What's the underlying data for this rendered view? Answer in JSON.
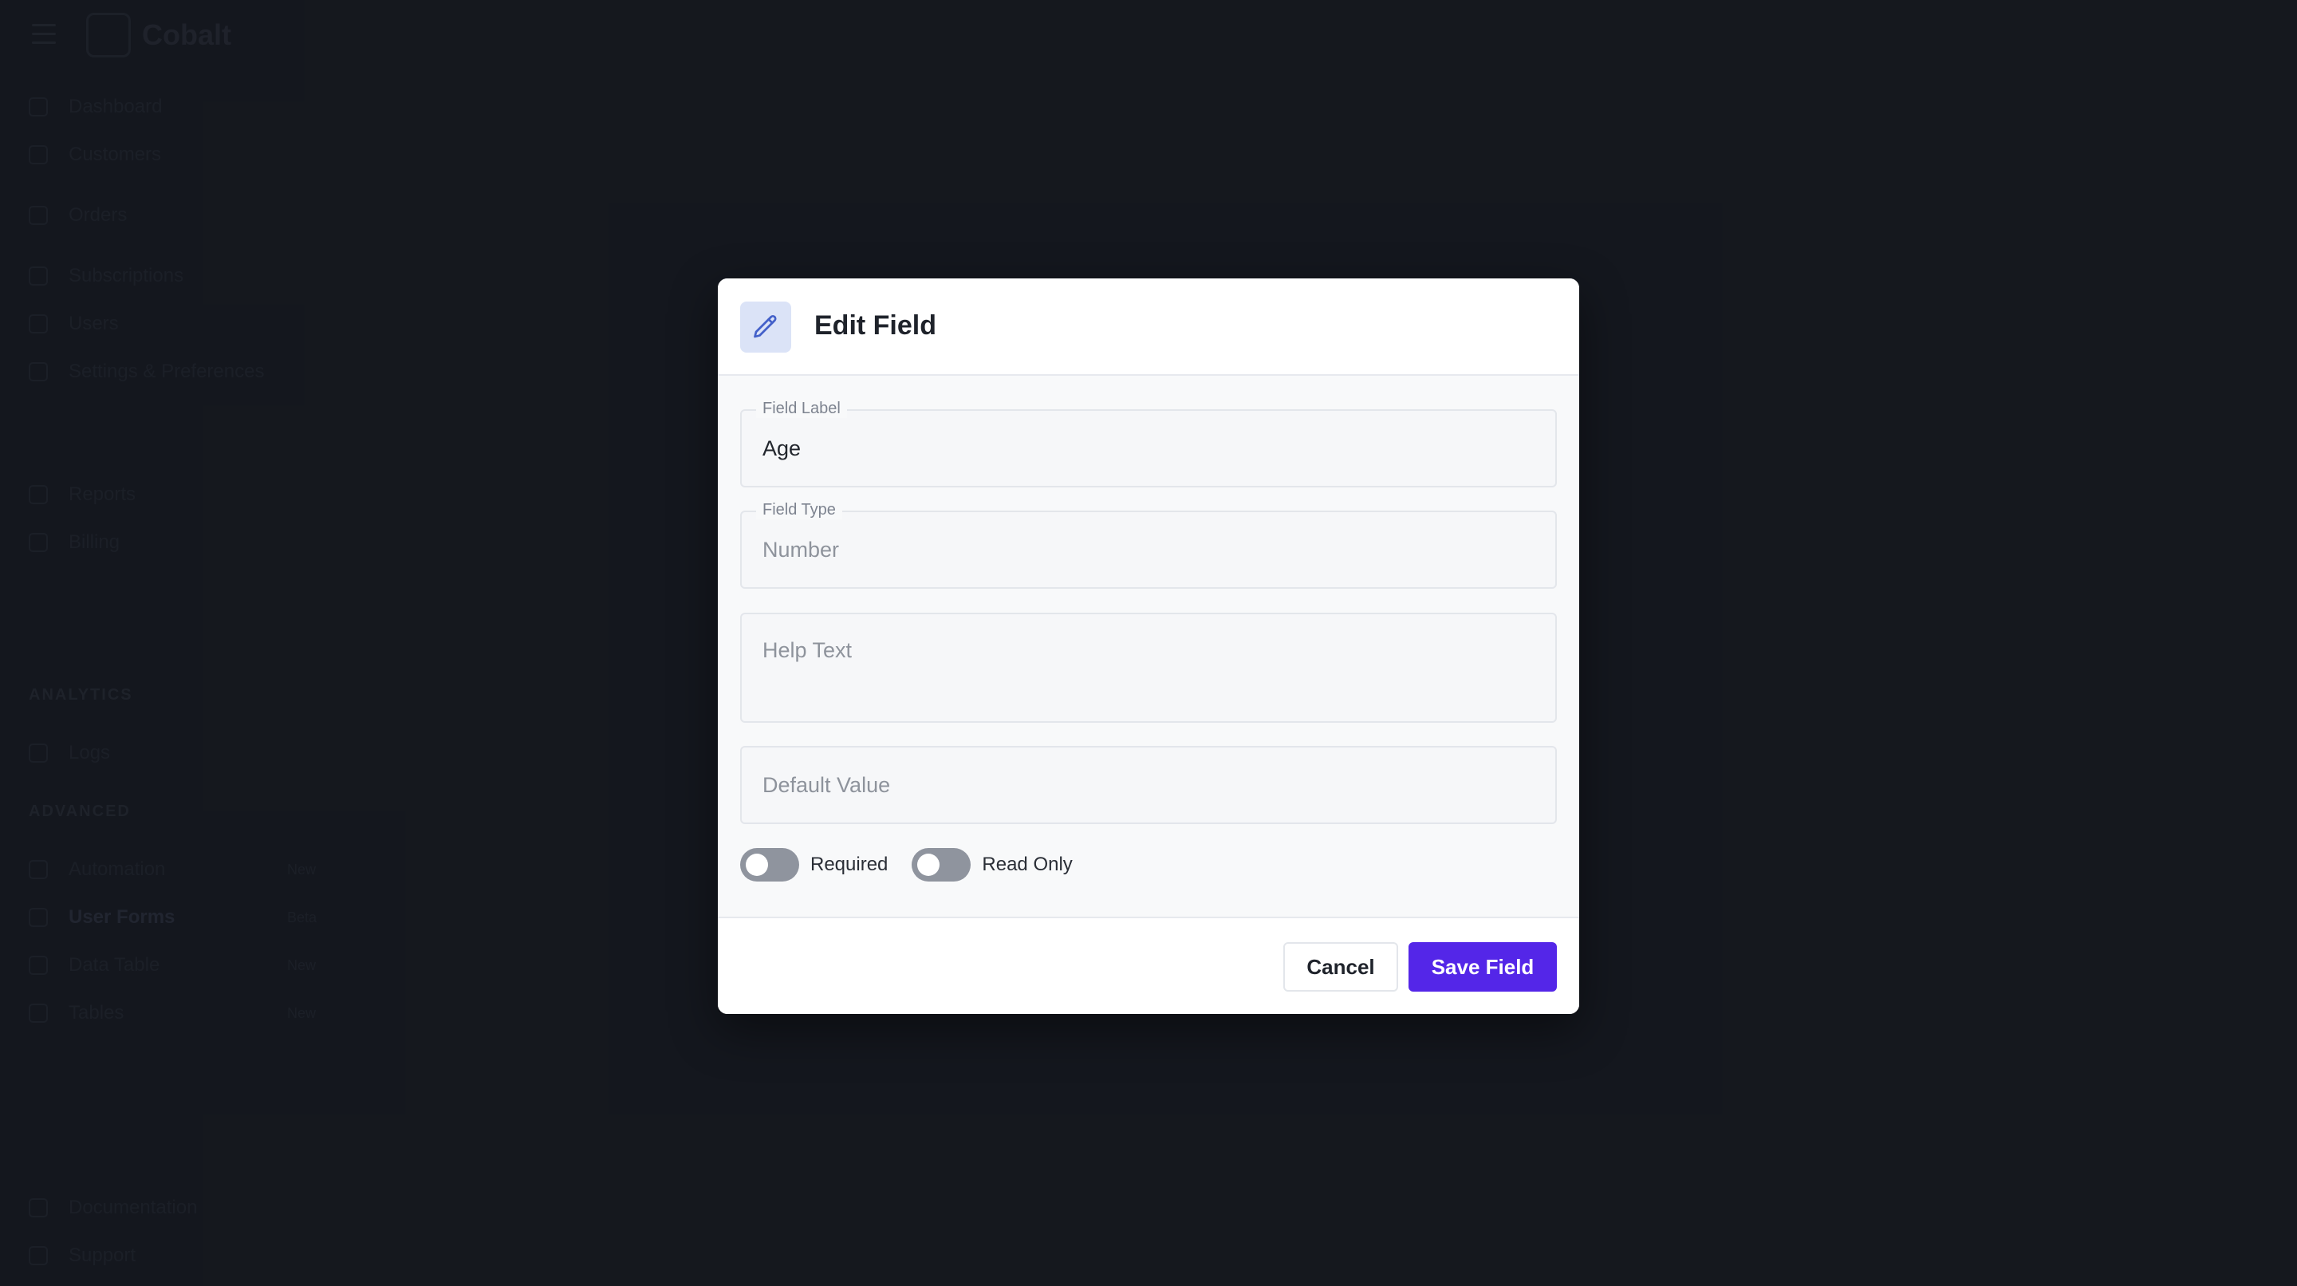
{
  "app": {
    "brand": "Cobalt",
    "sidebar": {
      "sections": [
        "ANALYTICS",
        "ADVANCED"
      ],
      "items": [
        {
          "label": "Dashboard"
        },
        {
          "label": "Customers"
        },
        {
          "label": "Orders"
        },
        {
          "label": "Subscriptions"
        },
        {
          "label": "Users"
        },
        {
          "label": "Settings & Preferences"
        },
        {
          "label": "Reports"
        },
        {
          "label": "Billing"
        },
        {
          "label": "Logs"
        },
        {
          "label": "Automation",
          "badge": "New"
        },
        {
          "label": "User Forms",
          "badge": "Beta"
        },
        {
          "label": "Data Table",
          "badge": "New"
        },
        {
          "label": "Tables",
          "badge": "New"
        },
        {
          "label": "Documentation"
        },
        {
          "label": "Support"
        }
      ]
    }
  },
  "modal": {
    "title": "Edit Field",
    "icon": "pencil-icon",
    "fields": {
      "label": {
        "legend": "Field Label",
        "value": "Age"
      },
      "type": {
        "legend": "Field Type",
        "value": "Number"
      },
      "help": {
        "placeholder": "Help Text"
      },
      "default": {
        "placeholder": "Default Value"
      }
    },
    "toggles": {
      "required": {
        "label": "Required",
        "on": false
      },
      "readonly": {
        "label": "Read Only",
        "on": false
      }
    },
    "buttons": {
      "cancel": "Cancel",
      "save": "Save Field"
    },
    "colors": {
      "primary": "#5426e8",
      "icon_bg": "#dbe3f7",
      "toggle_off": "#8f949e"
    }
  }
}
